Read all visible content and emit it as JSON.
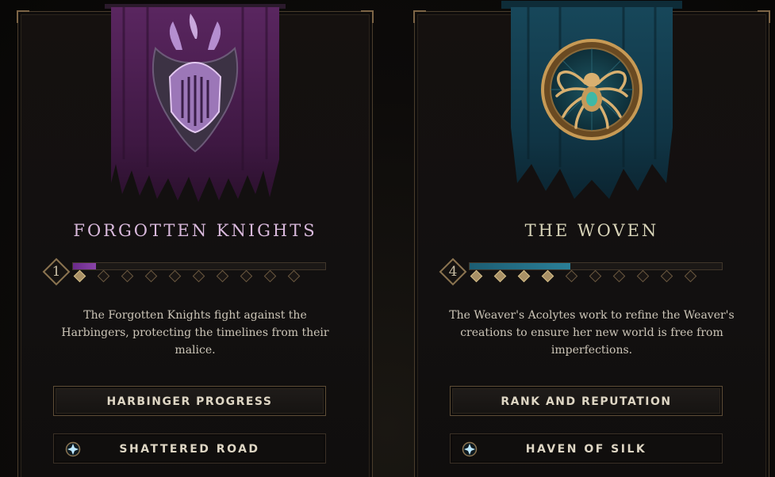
{
  "factions": [
    {
      "name": "FORGOTTEN KNIGHTS",
      "rank": "1",
      "progress_fraction": 0.09,
      "nodes_total": 10,
      "nodes_filled": 1,
      "description": "The Forgotten Knights fight against the Harbingers, protecting the timelines from their malice.",
      "primary_button": "HARBINGER PROGRESS",
      "secondary_button": "SHATTERED ROAD",
      "banner_color": "#4a1e4c",
      "emblem_icon": "knight-helm-icon"
    },
    {
      "name": "THE WOVEN",
      "rank": "4",
      "progress_fraction": 0.4,
      "nodes_total": 10,
      "nodes_filled": 4,
      "description": "The Weaver's Acolytes work to refine the Weaver's creations to ensure her new world is free from imperfections.",
      "primary_button": "RANK AND REPUTATION",
      "secondary_button": "HAVEN OF SILK",
      "banner_color": "#143c4c",
      "emblem_icon": "spider-emblem-icon"
    }
  ],
  "colors": {
    "border_gold": "#7d6546",
    "knight_purple": "#8a44a8",
    "woven_teal": "#2a7f97"
  },
  "secondary_button_icon": "waypoint-icon"
}
